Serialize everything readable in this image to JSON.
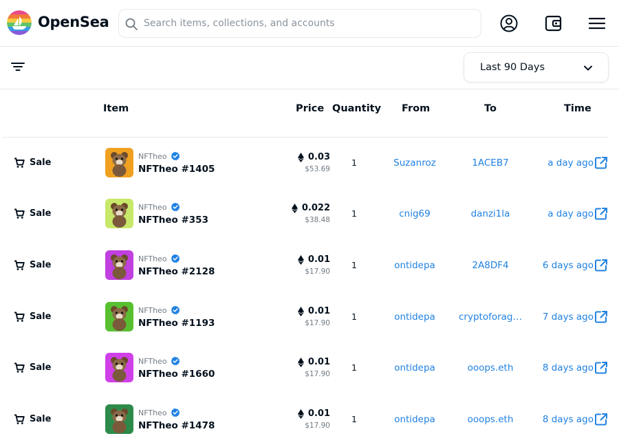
{
  "header": {
    "brand": "OpenSea",
    "search_placeholder": "Search items, collections, and accounts"
  },
  "toolbar": {
    "period_label": "Last 90 Days"
  },
  "table": {
    "columns": [
      "Item",
      "Price",
      "Quantity",
      "From",
      "To",
      "Time"
    ],
    "rows": [
      {
        "event": "Sale",
        "collection": "NFTheo",
        "name": "NFTheo #1405",
        "price_eth": "0.03",
        "price_usd": "$53.69",
        "quantity": "1",
        "from": "Suzanroz",
        "to": "1ACEB7",
        "time": "a day ago",
        "thumb_color": "#f0a020"
      },
      {
        "event": "Sale",
        "collection": "NFTheo",
        "name": "NFTheo #353",
        "price_eth": "0.022",
        "price_usd": "$38.48",
        "quantity": "1",
        "from": "cnig69",
        "to": "danzi1la",
        "time": "a day ago",
        "thumb_color": "#c8e86a"
      },
      {
        "event": "Sale",
        "collection": "NFTheo",
        "name": "NFTheo #2128",
        "price_eth": "0.01",
        "price_usd": "$17.90",
        "quantity": "1",
        "from": "ontidepa",
        "to": "2A8DF4",
        "time": "6 days ago",
        "thumb_color": "#c040e0"
      },
      {
        "event": "Sale",
        "collection": "NFTheo",
        "name": "NFTheo #1193",
        "price_eth": "0.01",
        "price_usd": "$17.90",
        "quantity": "1",
        "from": "ontidepa",
        "to": "cryptoforag…",
        "time": "7 days ago",
        "thumb_color": "#58c030"
      },
      {
        "event": "Sale",
        "collection": "NFTheo",
        "name": "NFTheo #1660",
        "price_eth": "0.01",
        "price_usd": "$17.90",
        "quantity": "1",
        "from": "ontidepa",
        "to": "ooops.eth",
        "time": "8 days ago",
        "thumb_color": "#d040e8"
      },
      {
        "event": "Sale",
        "collection": "NFTheo",
        "name": "NFTheo #1478",
        "price_eth": "0.01",
        "price_usd": "$17.90",
        "quantity": "1",
        "from": "ontidepa",
        "to": "ooops.eth",
        "time": "8 days ago",
        "thumb_color": "#2e8a4a"
      }
    ]
  },
  "colors": {
    "link": "#2081e2",
    "verified": "#2081e2",
    "text": "#04111d",
    "muted": "#707a83",
    "border": "#e5e8eb"
  },
  "icons": {
    "search": "search-icon",
    "account": "account-icon",
    "wallet": "wallet-icon",
    "menu": "menu-icon",
    "filter": "filter-icon",
    "chevron": "chevron-down-icon",
    "cart": "cart-icon",
    "verified": "verified-badge-icon",
    "eth": "eth-icon",
    "external": "external-link-icon"
  }
}
